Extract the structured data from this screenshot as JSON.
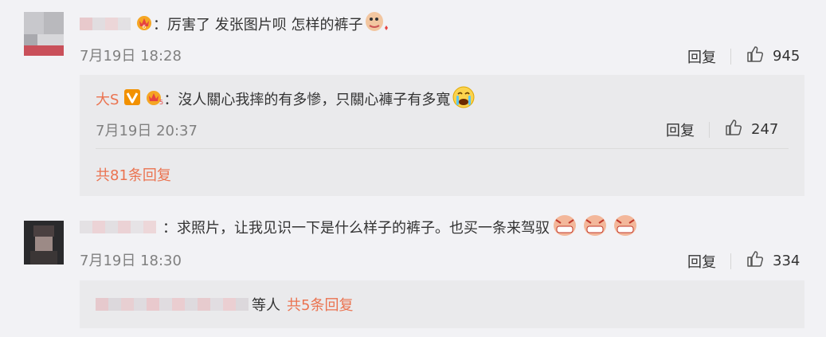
{
  "comments": [
    {
      "text": "：厉害了 发张图片呗 怎样的裤子",
      "time": "7月19日 18:28",
      "reply_label": "回复",
      "likes": "945",
      "reply": {
        "author": "大S",
        "text": "：沒人關心我摔的有多慘，只關心褲子有多寬",
        "time": "7月19日 20:37",
        "reply_label": "回复",
        "likes": "247",
        "more": "共81条回复"
      }
    },
    {
      "text": "：求照片，让我见识一下是什么样子的裤子。也买一条来驾驭",
      "time": "7月19日 18:30",
      "reply_label": "回复",
      "likes": "334",
      "reply": {
        "others": "等人",
        "more": "共5条回复"
      }
    }
  ],
  "colors": {
    "accent": "#eb7350",
    "meta": "#808080",
    "box": "#eaeaec"
  },
  "icons": [
    "thumb-up-icon",
    "vip-crown-icon",
    "verified-v-icon",
    "crying-face-icon",
    "sticker-icon"
  ]
}
